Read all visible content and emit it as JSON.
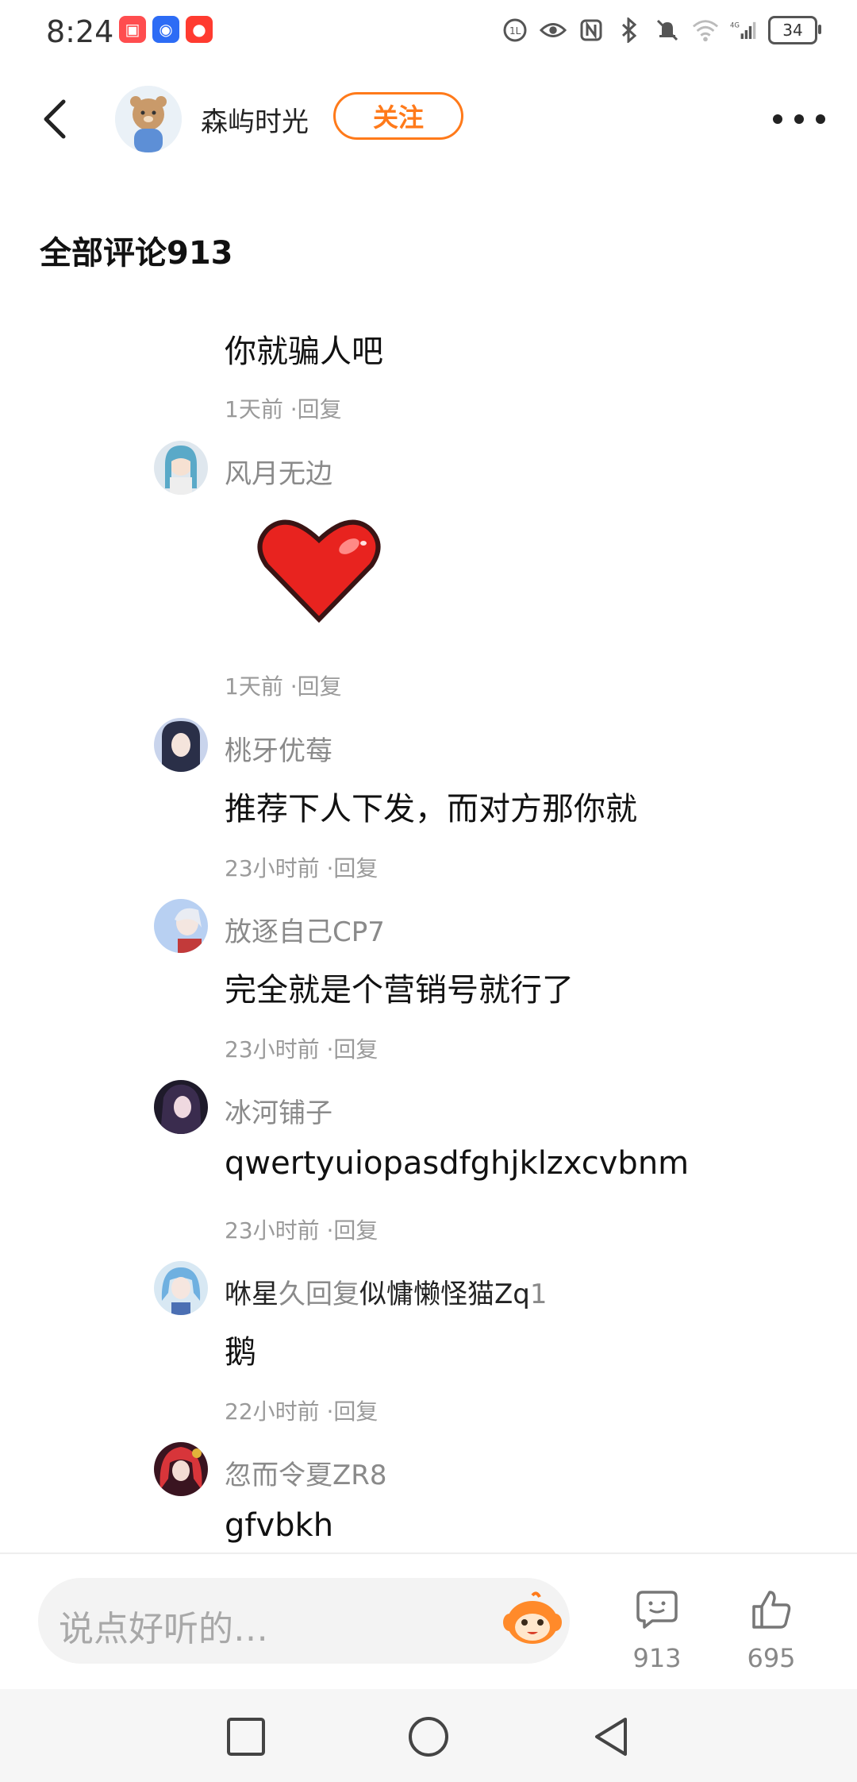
{
  "status_bar": {
    "time": "8:24",
    "battery": "34"
  },
  "header": {
    "author_name": "森屿时光",
    "follow_label": "关注"
  },
  "section": {
    "title": "全部评论913"
  },
  "comments": [
    {
      "text": "你就骗人吧",
      "meta": "1天前 ·回复"
    },
    {
      "name": "风月无边",
      "meta": "1天前 ·回复"
    },
    {
      "name": "桃牙优莓",
      "text": "推荐下人下发，而对方那你就",
      "meta": "23小时前 ·回复"
    },
    {
      "name": "放逐自己CP7",
      "text": "完全就是个营销号就行了",
      "meta": "23小时前 ·回复"
    },
    {
      "name": "冰河铺子",
      "text": "qwertyuiopasdfghjklzxcvbnm",
      "meta": "23小时前 ·回复"
    },
    {
      "name_part1": "咻星",
      "name_part2": "久回复",
      "name_part3": "似慵懒怪猫Zq",
      "name_part4": "1",
      "text": "鹅",
      "meta": "22小时前 ·回复"
    },
    {
      "name": "忽而令夏ZR8",
      "text": "gfvbkh"
    }
  ],
  "bottom_bar": {
    "input_placeholder": "说点好听的…",
    "comment_count": "913",
    "like_count": "695"
  },
  "colors": {
    "accent": "#ff7a1a",
    "heart": "#e8231f"
  }
}
